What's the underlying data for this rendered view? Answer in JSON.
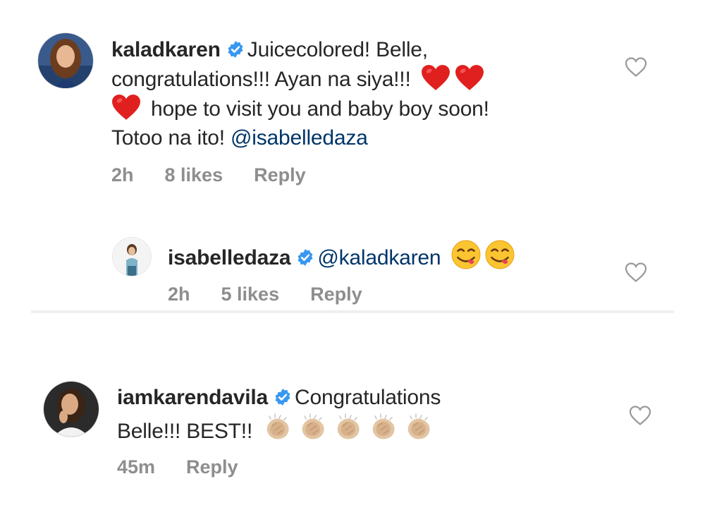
{
  "comments": [
    {
      "username": "kaladkaren",
      "text_line1": "Juicecolored! Belle,",
      "text_line2": "congratulations!!! Ayan na siya!!!",
      "text_line3": "hope to visit you and baby boy soon!",
      "text_line4": "Totoo na ito!",
      "mention": "@isabelledaza",
      "time": "2h",
      "likes": "8 likes",
      "reply_label": "Reply",
      "emojis": [
        "red-heart",
        "red-heart",
        "red-heart"
      ]
    },
    {
      "username": "isabelledaza",
      "mention": "@kaladkaren",
      "time": "2h",
      "likes": "5 likes",
      "reply_label": "Reply",
      "emojis": [
        "savoring-food-face",
        "savoring-food-face"
      ]
    },
    {
      "username": "iamkarendavila",
      "text_line1": "Congratulations",
      "text_line2": "Belle!!! BEST!!",
      "time": "45m",
      "reply_label": "Reply",
      "emojis": [
        "clapping-hands",
        "clapping-hands",
        "clapping-hands",
        "clapping-hands",
        "clapping-hands"
      ]
    }
  ],
  "colors": {
    "username": "#262626",
    "mention": "#003569",
    "meta": "#8e8e8e",
    "verified": "#3897f0"
  }
}
